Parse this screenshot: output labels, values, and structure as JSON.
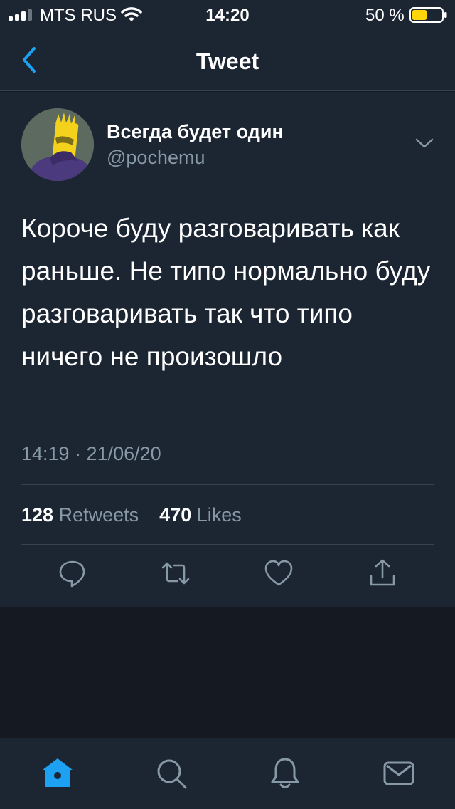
{
  "status_bar": {
    "carrier": "MTS RUS",
    "time": "14:20",
    "battery_percent": "50 %",
    "battery_level": 0.5,
    "battery_color": "#ffd60a"
  },
  "nav": {
    "title": "Tweet",
    "back_icon": "chevron-left-icon"
  },
  "tweet": {
    "author_name": "Всегда будет один",
    "author_handle": "@pochemu",
    "text": "Короче буду разговаривать как раньше. Не типо нормально буду разговаривать так что типо ничего не произошло",
    "timestamp": "14:19 · 21/06/20",
    "retweets_count": "128",
    "retweets_label": "Retweets",
    "likes_count": "470",
    "likes_label": "Likes"
  },
  "actions": [
    "reply-icon",
    "retweet-icon",
    "like-icon",
    "share-icon"
  ],
  "tab_bar": [
    "home-icon",
    "search-icon",
    "notifications-icon",
    "messages-icon"
  ],
  "colors": {
    "background": "#141922",
    "surface": "#1c2532",
    "accent": "#1da1f2",
    "secondary_text": "#8899a6",
    "divider": "#38444d"
  }
}
